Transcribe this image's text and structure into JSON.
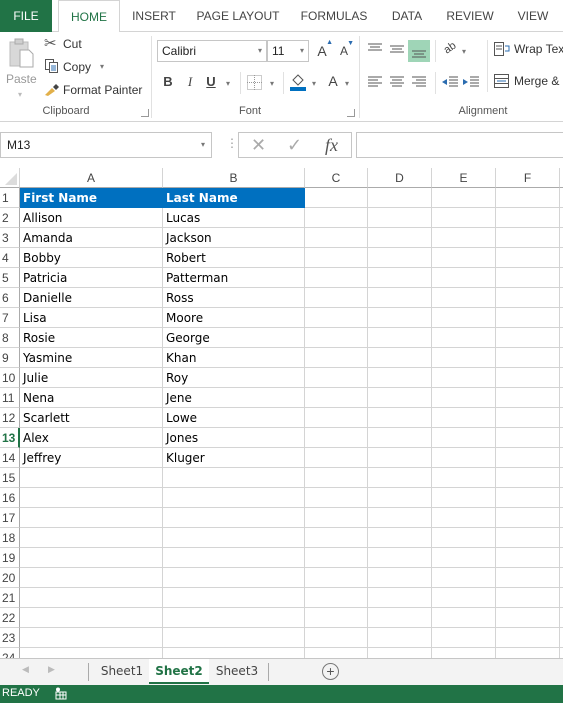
{
  "ribbon_tabs": [
    "FILE",
    "HOME",
    "INSERT",
    "PAGE LAYOUT",
    "FORMULAS",
    "DATA",
    "REVIEW",
    "VIEW"
  ],
  "active_tab": "HOME",
  "clipboard": {
    "paste": "Paste",
    "cut": "Cut",
    "copy": "Copy",
    "format_painter": "Format Painter",
    "group_label": "Clipboard"
  },
  "font": {
    "name": "Calibri",
    "size": "11",
    "bold": "B",
    "italic": "I",
    "underline": "U",
    "font_color_glyph": "A",
    "increase_glyph": "A",
    "decrease_glyph": "A",
    "group_label": "Font"
  },
  "alignment": {
    "wrap_text": "Wrap Text",
    "merge": "Merge & Center",
    "group_label": "Alignment"
  },
  "formula_bar": {
    "name_box": "M13",
    "cancel_glyph": "✕",
    "enter_glyph": "✓",
    "fx": "fx",
    "value": ""
  },
  "columns": [
    "A",
    "B",
    "C",
    "D",
    "E",
    "F"
  ],
  "header_row": [
    "First Name",
    "Last Name"
  ],
  "rows": [
    [
      "Allison",
      "Lucas"
    ],
    [
      "Amanda",
      "Jackson"
    ],
    [
      "Bobby",
      "Robert"
    ],
    [
      "Patricia",
      "Patterman"
    ],
    [
      "Danielle",
      "Ross"
    ],
    [
      "Lisa",
      "Moore"
    ],
    [
      "Rosie",
      "George"
    ],
    [
      "Yasmine",
      "Khan"
    ],
    [
      "Julie",
      "Roy"
    ],
    [
      "Nena",
      "Jene"
    ],
    [
      "Scarlett",
      "Lowe"
    ],
    [
      "Alex",
      "Jones"
    ],
    [
      "Jeffrey",
      "Kluger"
    ]
  ],
  "row_numbers": [
    "1",
    "2",
    "3",
    "4",
    "5",
    "6",
    "7",
    "8",
    "9",
    "10",
    "11",
    "12",
    "13",
    "14",
    "15",
    "16",
    "17",
    "18",
    "19",
    "20",
    "21",
    "22",
    "23",
    "24"
  ],
  "active_row": "13",
  "header_fill": "#0070c0",
  "sheets": [
    "Sheet1",
    "Sheet2",
    "Sheet3"
  ],
  "active_sheet": "Sheet2",
  "add_sheet_glyph": "+",
  "status": "READY",
  "accent": "#217346"
}
